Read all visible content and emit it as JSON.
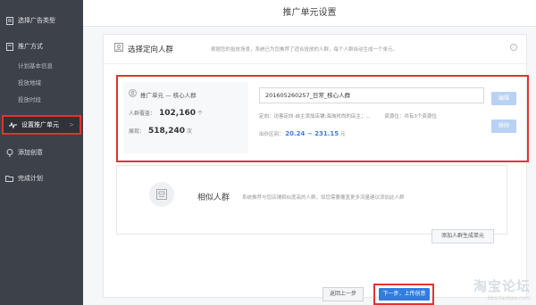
{
  "sidebar": {
    "items": [
      {
        "label": "选择广告类型"
      },
      {
        "label": "推广方式"
      },
      {
        "label": "添加创意"
      },
      {
        "label": "完成计划"
      }
    ],
    "sub_items": [
      "计划基本信息",
      "投放地域",
      "投放时段"
    ],
    "active_item": {
      "label": "设置推广单元",
      "arrow": ">"
    }
  },
  "header": {
    "title": "推广单元设置"
  },
  "section": {
    "title": "选择定向人群",
    "desc": "根据您的投放场景，系统已为您推荐了适合投放的人群，每个人群自动生成一个单元。",
    "info": "i"
  },
  "unit": {
    "name": "推广单元 — 核心人群",
    "coverage_label": "人群覆盖：",
    "coverage_value": "102,160",
    "coverage_unit": "个",
    "exposure_label": "展现：",
    "exposure_value": "518,240",
    "exposure_unit": "次",
    "input_value": "201605260257_日常_核心人群",
    "targeting": "定向：访客定向-自主添加店铺;海淘时尚的店主；...",
    "resource": "资源位：共有3个资源位",
    "bid_label": "出价区间：",
    "bid_range": "20.24 ~ 231.15",
    "bid_unit": "元",
    "edit_label": "编辑",
    "delete_label": "移除"
  },
  "similar": {
    "title": "相似人群",
    "desc": "系统推荐与您店铺相似度高的人群，如您需要覆盖更多流量建议添加此人群",
    "add_label": "添加人群生成单元"
  },
  "footer": {
    "prev_label": "返回上一步",
    "next_label": "下一步，上传创意"
  },
  "watermark": {
    "title": "淘宝论坛",
    "url": "bbs.taobao.com"
  },
  "colors": {
    "accent": "#2f7de1",
    "highlight": "#e8312f",
    "sidebar": "#3d4149"
  }
}
